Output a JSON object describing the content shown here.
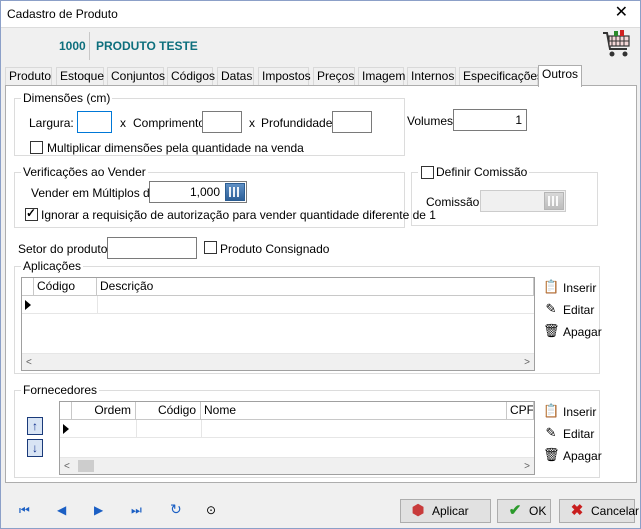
{
  "window": {
    "title": "Cadastro de Produto",
    "close": "✕"
  },
  "header": {
    "code": "1000",
    "product_name": "PRODUTO TESTE"
  },
  "tabs": [
    {
      "label": "Produto"
    },
    {
      "label": "Estoque"
    },
    {
      "label": "Conjuntos"
    },
    {
      "label": "Códigos"
    },
    {
      "label": "Datas"
    },
    {
      "label": "Impostos"
    },
    {
      "label": "Preços"
    },
    {
      "label": "Imagem"
    },
    {
      "label": "Internos"
    },
    {
      "label": "Especificações"
    },
    {
      "label": "Outros"
    }
  ],
  "dimensions": {
    "legend": "Dimensões (cm)",
    "largura_label": "Largura:",
    "largura_value": "",
    "x1": "x",
    "comprimento_label": "Comprimento:",
    "comprimento_value": "",
    "x2": "x",
    "profundidade_label": "Profundidade:",
    "profundidade_value": "",
    "multiply_label": "Multiplicar dimensões pela quantidade na venda",
    "multiply_checked": false
  },
  "volumes": {
    "label": "Volumes:",
    "value": "1"
  },
  "verificacoes": {
    "legend": "Verificações ao Vender",
    "multiplos_label": "Vender em Múltiplos de:",
    "multiplos_value": "1,000",
    "ignore_label": "Ignorar a requisição de autorização para vender quantidade diferente de 1",
    "ignore_checked": true
  },
  "comissao": {
    "legend": "Definir Comissão",
    "label": "Comissão:",
    "value": ""
  },
  "setor": {
    "label": "Setor do produto:",
    "value": "",
    "consignado_label": "Produto Consignado"
  },
  "aplicacoes": {
    "legend": "Aplicações",
    "columns": [
      "Código",
      "Descrição"
    ],
    "buttons": {
      "insert": "Inserir",
      "edit": "Editar",
      "delete": "Apagar"
    }
  },
  "fornecedores": {
    "legend": "Fornecedores",
    "columns": [
      "Ordem",
      "Código",
      "Nome",
      "CPF"
    ],
    "buttons": {
      "insert": "Inserir",
      "edit": "Editar",
      "delete": "Apagar"
    }
  },
  "footer": {
    "apply": "Aplicar",
    "ok": "OK",
    "cancel": "Cancelar"
  },
  "icons": {
    "first": "first-record-icon",
    "prev": "previous-record-icon",
    "next": "next-record-icon",
    "last": "last-record-icon",
    "refresh": "refresh-icon",
    "search": "search-icon"
  },
  "colors": {
    "accent": "#0d6f7d",
    "nav": "#1b5fc4"
  }
}
